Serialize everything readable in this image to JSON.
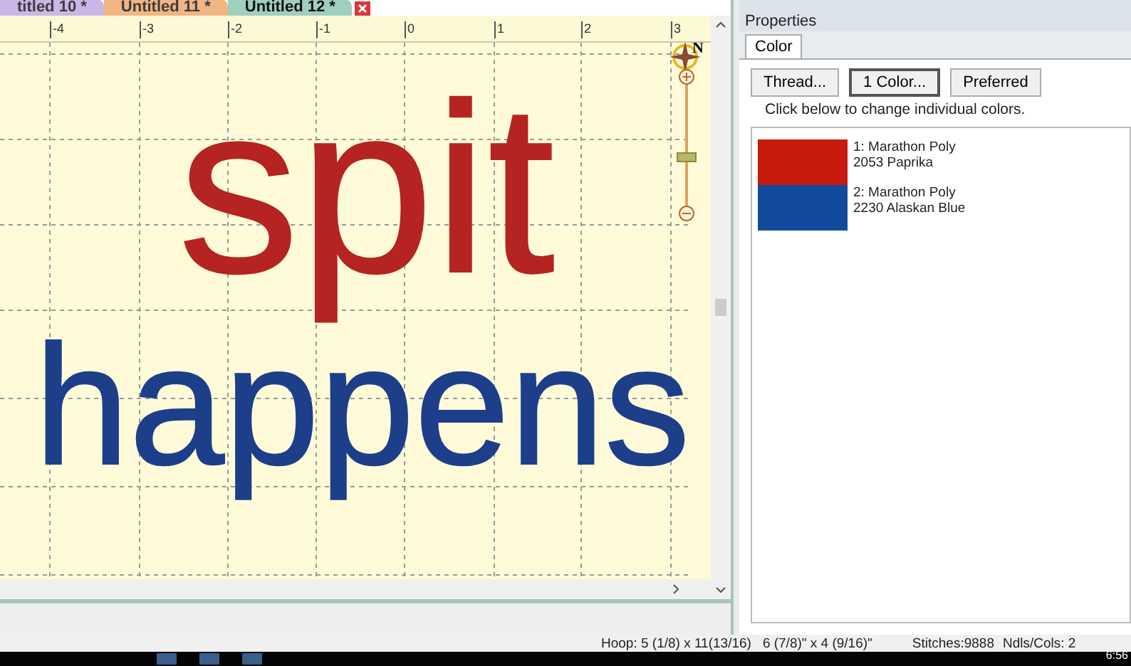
{
  "document_tabs": [
    {
      "label": "titled 10 *",
      "selected": false,
      "color": "#c9b3e6"
    },
    {
      "label": "Untitled 11 *",
      "selected": false,
      "color": "#f2b27e"
    },
    {
      "label": "Untitled 12 *",
      "selected": true,
      "color": "#9fcfbf"
    }
  ],
  "ruler": {
    "ticks": [
      "-4",
      "-3",
      "-2",
      "-1",
      "0",
      "1",
      "2",
      "3"
    ]
  },
  "compass": {
    "label": "N"
  },
  "zoom_slider": {
    "level": 0.41
  },
  "design": {
    "lines": [
      {
        "text": "spit",
        "color": "#b52420"
      },
      {
        "text": "happens",
        "color": "#1d3f8a"
      }
    ]
  },
  "properties": {
    "title": "Properties",
    "tabs": [
      {
        "label": "Color",
        "selected": true
      }
    ],
    "buttons": [
      {
        "label": "Thread...",
        "selected": false
      },
      {
        "label": "1 Color...",
        "selected": true
      },
      {
        "label": "Preferred",
        "selected": false
      }
    ],
    "hint": "Click below to change individual colors.",
    "colors": [
      {
        "name": "1: Marathon Poly",
        "code": "2053 Paprika",
        "color": "#c81b0e"
      },
      {
        "name": "2: Marathon Poly",
        "code": "2230 Alaskan Blue",
        "color": "#134b9c"
      }
    ]
  },
  "status_bar": [
    "Hoop: 5 (1/8) x 11(13/16)",
    "6 (7/8)\" x 4 (9/16)\"",
    "Stitches:9888",
    "Ndls/Cols: 2"
  ],
  "taskbar": {
    "clock": "6:56"
  }
}
